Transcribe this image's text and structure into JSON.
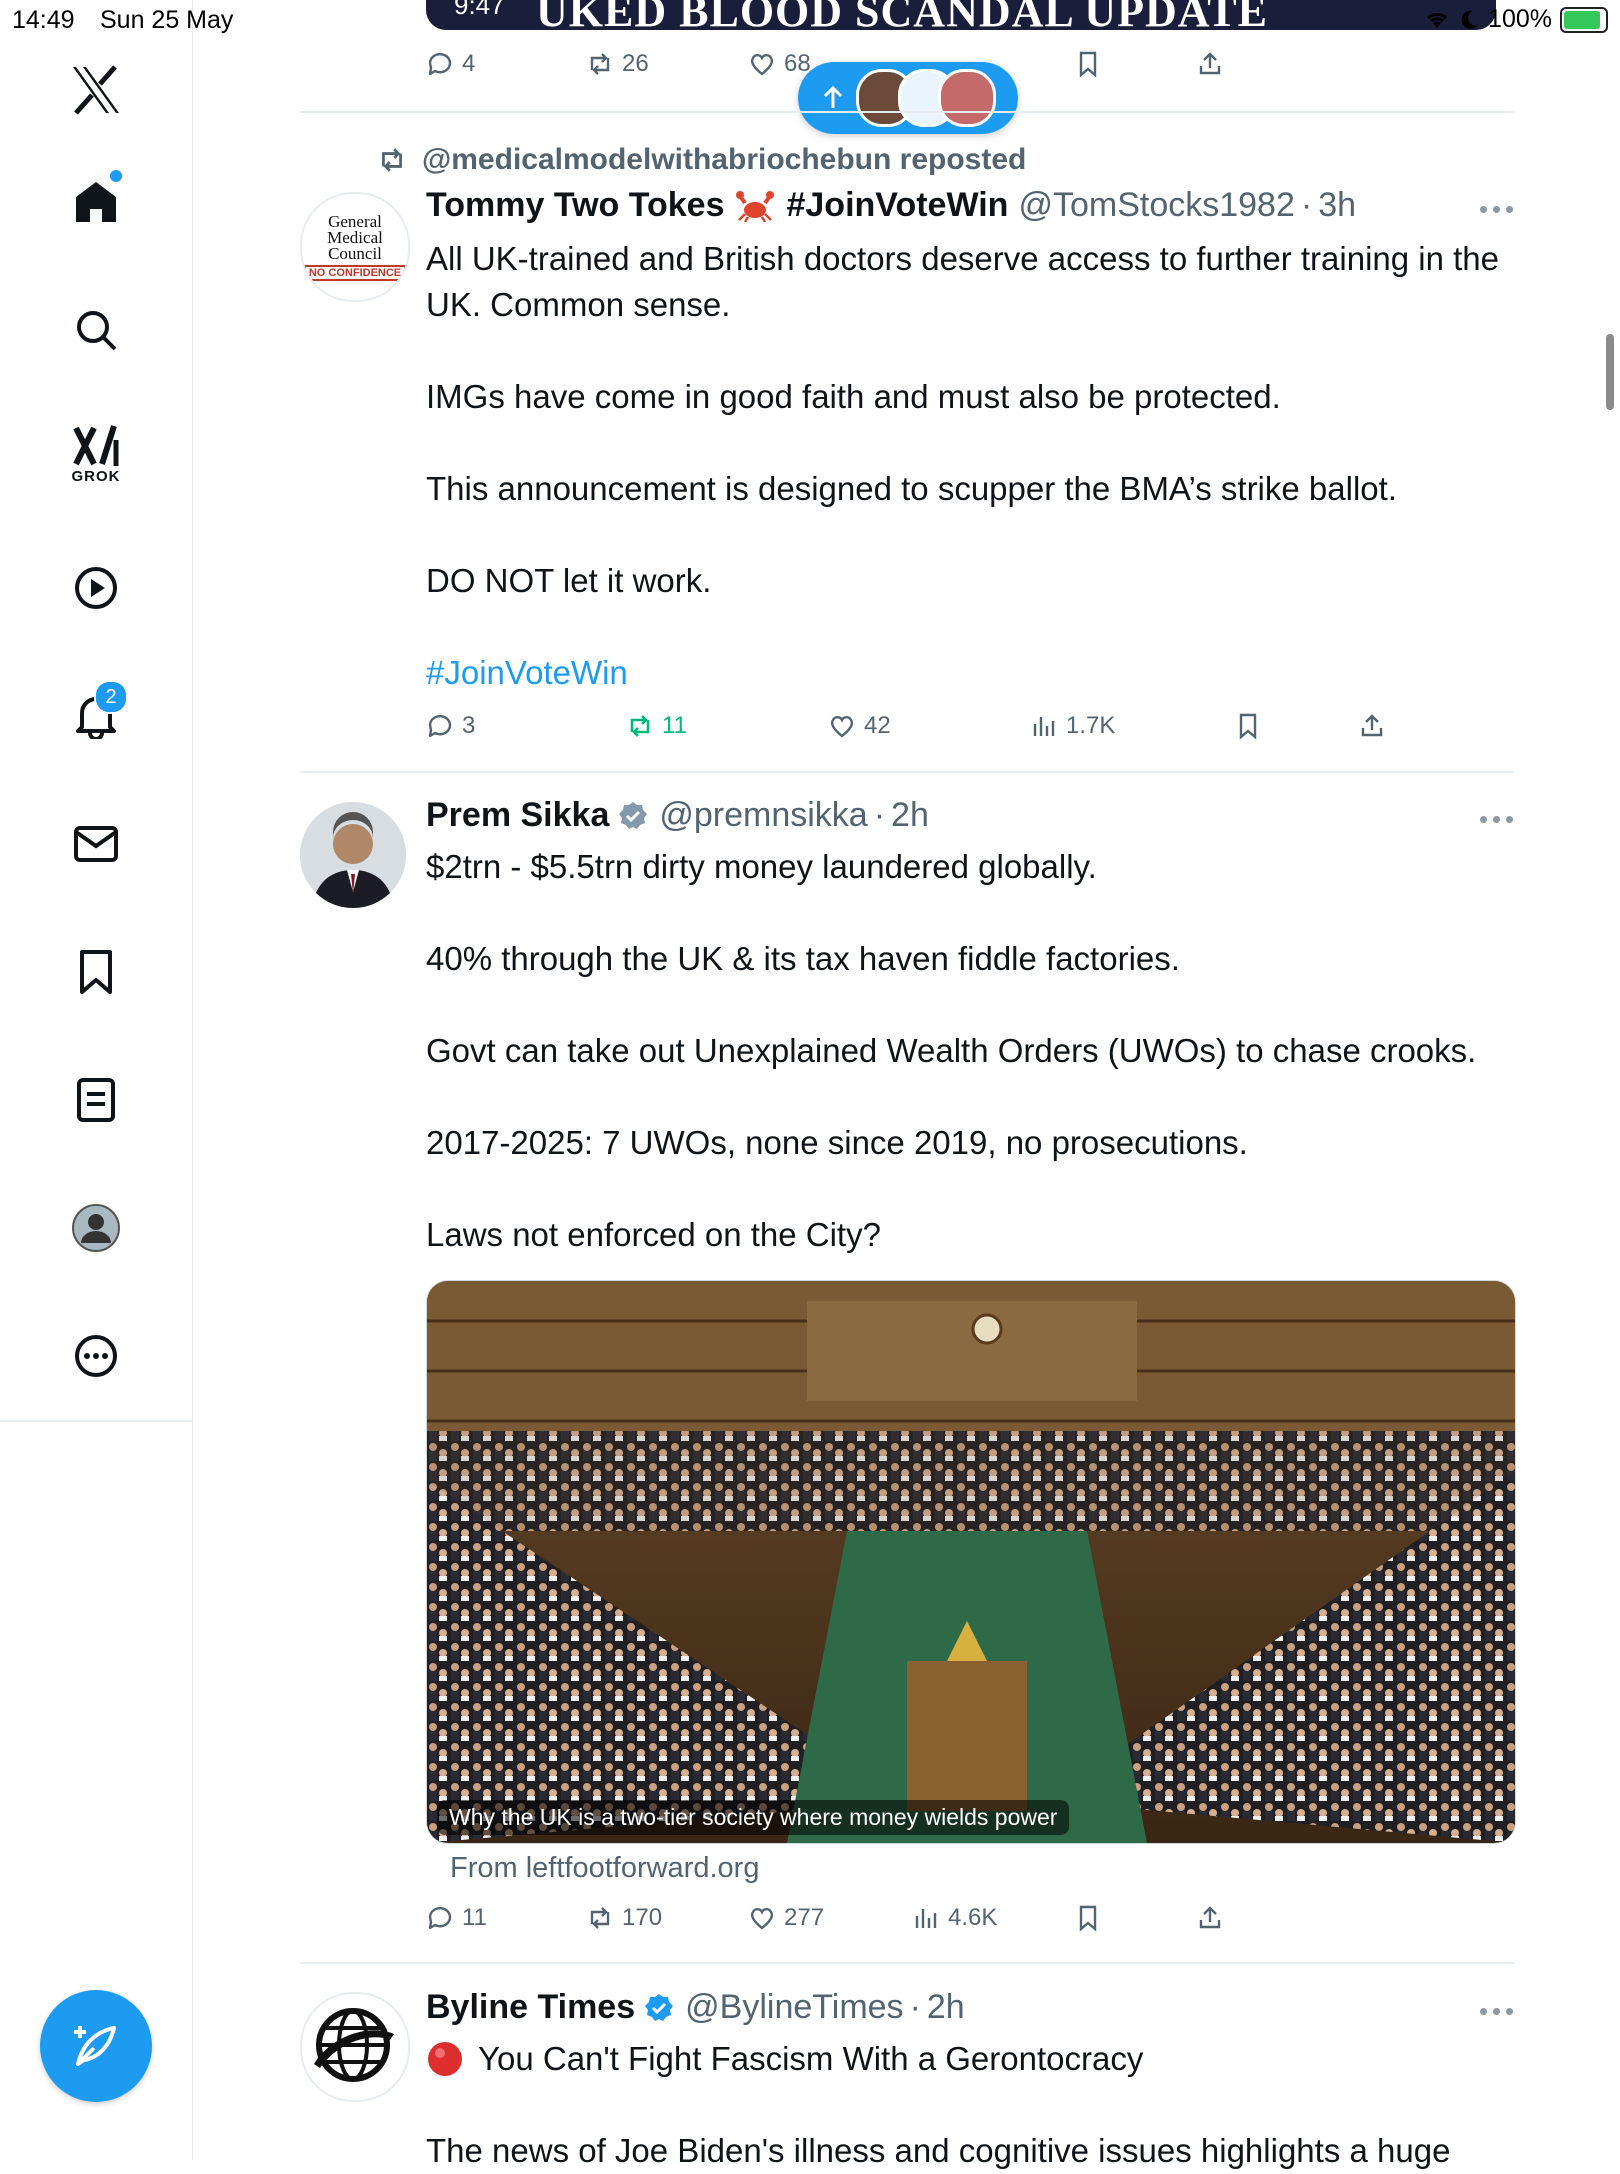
{
  "status_bar": {
    "time": "14:49",
    "date": "Sun 25 May",
    "battery": "100%"
  },
  "sidebar": {
    "grok_label": "GROK",
    "notifications_badge": "2"
  },
  "prev_tweet": {
    "banner_text": "UKED BLOOD SCANDAL UPDATE",
    "video_duration": "9:47",
    "replies": "4",
    "reposts": "26",
    "likes": "68"
  },
  "repost_context": {
    "text": "@medicalmodelwithabriochebun reposted"
  },
  "tweets": [
    {
      "avatar_text": [
        "General",
        "Medical",
        "Council"
      ],
      "avatar_badge": "NO CONFIDENCE",
      "name": "Tommy Two Tokes",
      "name_suffix": "#JoinVoteWin",
      "handle": "@TomStocks1982",
      "time": "3h",
      "paragraphs": [
        "All UK-trained and British doctors deserve access to further training in the UK. Common sense.",
        "IMGs have come in good faith and must also be protected.",
        "This announcement is designed to scupper the BMA’s strike ballot.",
        "DO NOT let it work."
      ],
      "hashtag": "#JoinVoteWin",
      "replies": "3",
      "reposts": "11",
      "likes": "42",
      "views": "1.7K"
    },
    {
      "name": "Prem Sikka",
      "handle": "@premnsikka",
      "time": "2h",
      "paragraphs": [
        "$2trn - $5.5trn dirty money laundered globally.",
        "40% through the UK & its tax haven fiddle factories.",
        "Govt can take out Unexplained Wealth Orders (UWOs) to chase crooks.",
        "2017-2025: 7 UWOs, none since 2019, no prosecutions.",
        "Laws not enforced on the City?"
      ],
      "card_caption": "Why the UK is a two-tier society where money wields power",
      "card_source": "From leftfootforward.org",
      "replies": "11",
      "reposts": "170",
      "likes": "277",
      "views": "4.6K"
    },
    {
      "name": "Byline Times",
      "handle": "@BylineTimes",
      "time": "2h",
      "headline": "You Can't Fight Fascism With a Gerontocracy",
      "body_partial": "The news of Joe Biden's illness and cognitive issues highlights a huge"
    }
  ],
  "colors": {
    "accent": "#1d9bf0",
    "repost_active": "#00ba7c",
    "muted": "#536471"
  },
  "icons": [
    "x-logo-icon",
    "home-icon",
    "search-icon",
    "grok-icon",
    "video-icon",
    "bell-icon",
    "mail-icon",
    "bookmark-icon",
    "list-icon",
    "profile-icon",
    "more-circle-icon",
    "compose-icon",
    "reply-icon",
    "repost-icon",
    "like-icon",
    "views-icon",
    "share-icon",
    "verified-icon",
    "crab-emoji-icon",
    "red-circle-emoji-icon"
  ]
}
